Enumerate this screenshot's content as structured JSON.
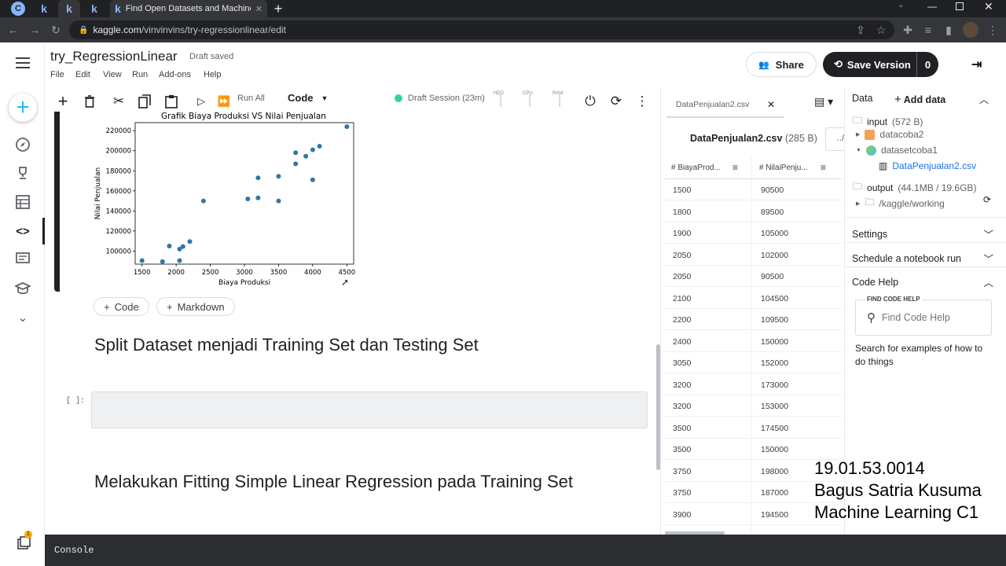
{
  "browser": {
    "active_tab_title": "Find Open Datasets and Machine",
    "url_host": "kaggle.com",
    "url_path": "/vinvinvins/try-regressionlinear/edit"
  },
  "notebook": {
    "title": "try_RegressionLinear",
    "draft_status": "Draft saved",
    "menus": [
      "File",
      "Edit",
      "View",
      "Run",
      "Add-ons",
      "Help"
    ],
    "share_label": "Share",
    "save_label": "Save Version",
    "save_count": "0",
    "run_all_label": "Run All",
    "cell_type": "Code",
    "session": "Draft Session (23m)",
    "hw": [
      "HDD",
      "CPU",
      "RAM"
    ]
  },
  "cell_buttons": {
    "code": "Code",
    "markdown": "Markdown"
  },
  "headings": {
    "split": "Split Dataset menjadi Training Set dan Testing Set",
    "fitting": "Melakukan Fitting Simple Linear Regression pada Training Set"
  },
  "cell_prompt": "[ ]:",
  "chart_data": {
    "type": "scatter",
    "title": "Grafik Biaya Produksi VS Nilai Penjualan",
    "xlabel": "Biaya Produksi",
    "ylabel": "Nilai Penjualan",
    "xlim": [
      1400,
      4600
    ],
    "ylim": [
      87000,
      228000
    ],
    "xticks": [
      1500,
      2000,
      2500,
      3000,
      3500,
      4000,
      4500
    ],
    "yticks": [
      100000,
      120000,
      140000,
      160000,
      180000,
      200000,
      220000
    ],
    "color": "#2e78a7",
    "points": [
      [
        1500,
        90500
      ],
      [
        1800,
        89500
      ],
      [
        1900,
        105000
      ],
      [
        2050,
        102000
      ],
      [
        2050,
        90500
      ],
      [
        2100,
        104500
      ],
      [
        2200,
        109500
      ],
      [
        2400,
        150000
      ],
      [
        3050,
        152000
      ],
      [
        3200,
        173000
      ],
      [
        3200,
        153000
      ],
      [
        3500,
        174500
      ],
      [
        3500,
        150000
      ],
      [
        3750,
        198000
      ],
      [
        3750,
        187000
      ],
      [
        3900,
        194500
      ],
      [
        4000,
        201000
      ],
      [
        4000,
        171000
      ],
      [
        4100,
        204500
      ],
      [
        4500,
        224000
      ]
    ]
  },
  "data_viewer": {
    "tab_name": "DataPenjualan2.csv",
    "file_title": "DataPenjualan2.csv",
    "file_size": "(285 B)",
    "path_btn": "../",
    "columns": [
      "BiayaProd...",
      "NilaiPenju..."
    ],
    "rows": [
      [
        "1500",
        "90500"
      ],
      [
        "1800",
        "89500"
      ],
      [
        "1900",
        "105000"
      ],
      [
        "2050",
        "102000"
      ],
      [
        "2050",
        "90500"
      ],
      [
        "2100",
        "104500"
      ],
      [
        "2200",
        "109500"
      ],
      [
        "2400",
        "150000"
      ],
      [
        "3050",
        "152000"
      ],
      [
        "3200",
        "173000"
      ],
      [
        "3200",
        "153000"
      ],
      [
        "3500",
        "174500"
      ],
      [
        "3500",
        "150000"
      ],
      [
        "3750",
        "198000"
      ],
      [
        "3750",
        "187000"
      ],
      [
        "3900",
        "194500"
      ]
    ]
  },
  "sidebar": {
    "data_label": "Data",
    "add_data_label": "Add data",
    "input_label": "input",
    "input_size": "(572 B)",
    "datasets": [
      "datacoba2",
      "datasetcoba1"
    ],
    "file": "DataPenjualan2.csv",
    "output_label": "output",
    "output_size": "(44.1MB / 19.6GB)",
    "working": "/kaggle/working",
    "settings": "Settings",
    "schedule": "Schedule a notebook run",
    "code_help": "Code Help",
    "find_code_help_label": "FIND CODE HELP",
    "find_code_help_placeholder": "Find Code Help",
    "help_text": "Search for examples of how to do things"
  },
  "console_label": "Console",
  "notif_count": "1",
  "watermark": [
    "19.01.53.0014",
    "Bagus Satria Kusuma",
    "Machine Learning C1"
  ]
}
